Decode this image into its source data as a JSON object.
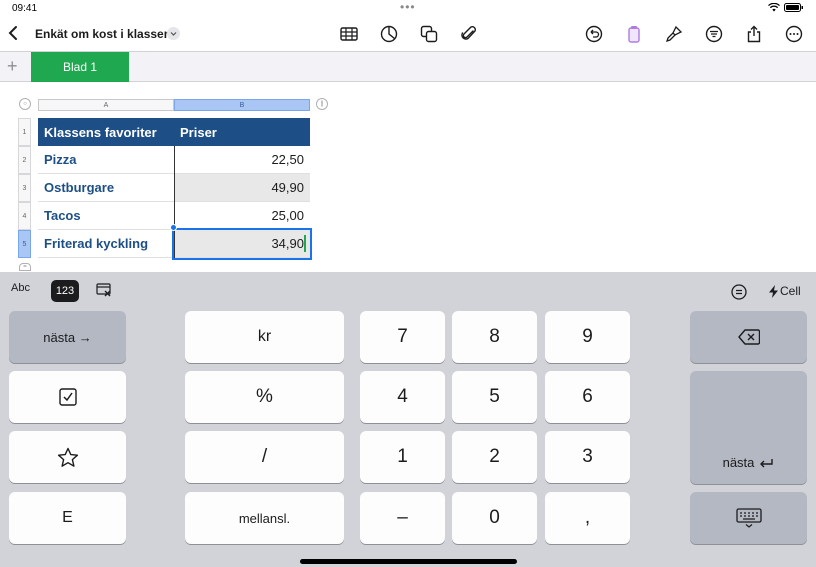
{
  "status": {
    "time": "09:41"
  },
  "toolbar": {
    "title": "Enkät om kost i klassen"
  },
  "sheet_tabs": [
    {
      "label": "Blad 1"
    }
  ],
  "table": {
    "columns": [
      "A",
      "B"
    ],
    "rows": [
      "1",
      "2",
      "3",
      "4",
      "5"
    ],
    "header": [
      "Klassens favoriter",
      "Priser"
    ],
    "data": [
      {
        "item": "Pizza",
        "price": "22,50"
      },
      {
        "item": "Ostburgare",
        "price": "49,90"
      },
      {
        "item": "Tacos",
        "price": "25,00"
      },
      {
        "item": "Friterad kyckling",
        "price": "34,90"
      }
    ]
  },
  "keyboard": {
    "modes": {
      "abc": "Abc",
      "num": "123",
      "cell": "Cell"
    },
    "next": "nästa →",
    "next_return": "nästa",
    "kr": "kr",
    "percent": "%",
    "slash": "/",
    "space": "mellansl.",
    "e": "E",
    "digits": [
      "7",
      "8",
      "9",
      "4",
      "5",
      "6",
      "1",
      "2",
      "3",
      "–",
      "0",
      ","
    ]
  },
  "colors": {
    "accent": "#1fa84f",
    "header": "#1d4f86",
    "selection": "#1a73e8"
  }
}
